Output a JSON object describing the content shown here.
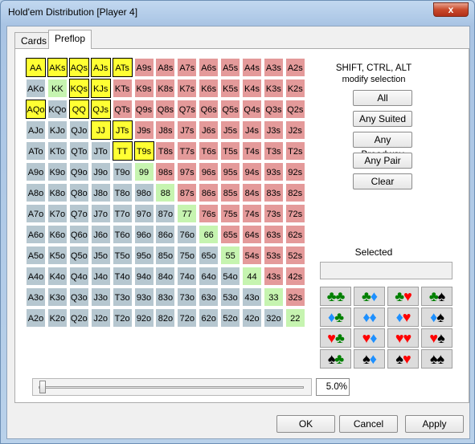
{
  "window": {
    "title": "Hold'em Distribution [Player 4]",
    "close_label": "x"
  },
  "tabs": [
    {
      "label": "Cards"
    },
    {
      "label": "Preflop"
    }
  ],
  "ranks": [
    "A",
    "K",
    "Q",
    "J",
    "T",
    "9",
    "8",
    "7",
    "6",
    "5",
    "4",
    "3",
    "2"
  ],
  "selected_hands": [
    "AA",
    "AKs",
    "AQs",
    "AJs",
    "ATs",
    "KQs",
    "KJs",
    "AQo",
    "QQ",
    "QJs",
    "JJ",
    "JTs",
    "TT",
    "T9s"
  ],
  "modifier_hint": {
    "line1": "SHIFT, CTRL, ALT",
    "line2": "modify selection"
  },
  "buttons": {
    "all": "All",
    "any_suited": "Any Suited",
    "any_broadway": "Any Broadway",
    "any_pair": "Any Pair",
    "clear": "Clear"
  },
  "selected": {
    "label": "Selected",
    "value": ""
  },
  "suit_combos": [
    [
      [
        "club",
        "club"
      ],
      [
        "club",
        "diamond"
      ],
      [
        "club",
        "heart"
      ],
      [
        "club",
        "spade"
      ]
    ],
    [
      [
        "diamond",
        "club"
      ],
      [
        "diamond",
        "diamond"
      ],
      [
        "diamond",
        "heart"
      ],
      [
        "diamond",
        "spade"
      ]
    ],
    [
      [
        "heart",
        "club"
      ],
      [
        "heart",
        "diamond"
      ],
      [
        "heart",
        "heart"
      ],
      [
        "heart",
        "spade"
      ]
    ],
    [
      [
        "spade",
        "club"
      ],
      [
        "spade",
        "diamond"
      ],
      [
        "spade",
        "heart"
      ],
      [
        "spade",
        "spade"
      ]
    ]
  ],
  "range_slider": {
    "value_percent": 5.0,
    "display": "5.0%"
  },
  "dialog_buttons": {
    "ok": "OK",
    "cancel": "Cancel",
    "apply": "Apply"
  }
}
